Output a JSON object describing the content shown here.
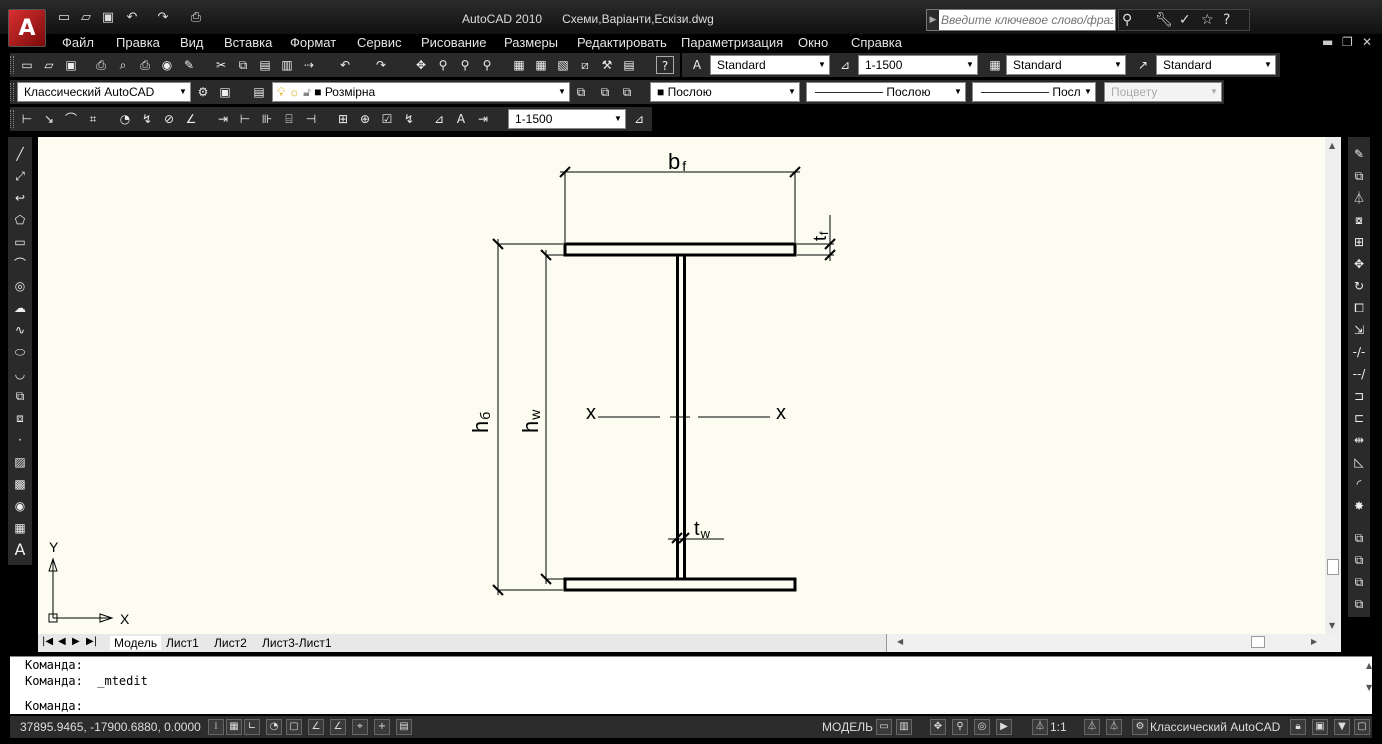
{
  "title": {
    "app_name": "AutoCAD 2010",
    "file_name": "Схеми,Варіанти,Ескізи.dwg",
    "search_placeholder": "Введите ключевое слово/фразу"
  },
  "menu": [
    "Файл",
    "Правка",
    "Вид",
    "Вставка",
    "Формат",
    "Сервис",
    "Рисование",
    "Размеры",
    "Редактировать",
    "Параметризация",
    "Окно",
    "Справка"
  ],
  "toolbar_styles": {
    "text_style": "Standard",
    "dim_style": "1-1500",
    "table_style": "Standard",
    "multileader_style": "Standard"
  },
  "toolbar_props": {
    "workspace": "Классический AutoCAD",
    "layer": "Розмірна",
    "color": "Послою",
    "linetype": "Послою",
    "lineweight": "Послою",
    "plotstyle": "Поцвету"
  },
  "toolbar_dim": {
    "dim_style": "1-1500"
  },
  "drawing": {
    "label_bf": "b",
    "label_bf_sub": "f",
    "label_tf": "t",
    "label_tf_sub": "f",
    "label_hb": "h",
    "label_hb_sub": "б",
    "label_hw": "h",
    "label_hw_sub": "w",
    "label_tw": "t",
    "label_tw_sub": "w",
    "axis_left": "x",
    "axis_right": "x",
    "ucs_x": "X",
    "ucs_y": "Y",
    "colors": {
      "background": "#fdfcf0",
      "lines": "#000000"
    }
  },
  "layout_tabs": [
    "Модель",
    "Лист1",
    "Лист2",
    "Лист3-Лист1"
  ],
  "command": {
    "line1": "Команда:",
    "line2": "Команда:  _mtedit",
    "prompt": "Команда:"
  },
  "status": {
    "coords": "37895.9465, -17900.6880, 0.0000",
    "model_label": "МОДЕЛЬ",
    "scale": "1:1",
    "workspace": "Классический AutoCAD"
  }
}
